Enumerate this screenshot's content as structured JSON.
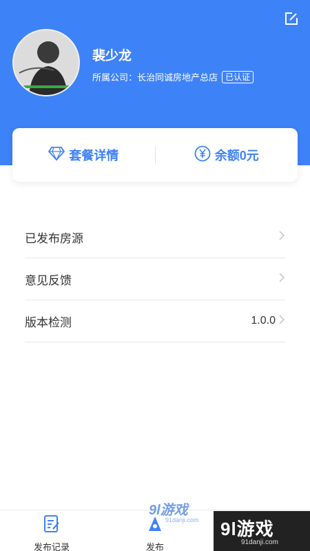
{
  "profile": {
    "name": "裴少龙",
    "company_label": "所属公司：",
    "company_name": "长治同诚房地产总店",
    "verified_badge": "已认证"
  },
  "card": {
    "package_label": "套餐详情",
    "balance_label": "余额0元"
  },
  "menu": {
    "items": [
      {
        "label": "已发布房源",
        "value": ""
      },
      {
        "label": "意见反馈",
        "value": ""
      },
      {
        "label": "版本检测",
        "value": "1.0.0"
      }
    ]
  },
  "tabs": {
    "records_label": "发布记录",
    "publish_label": "发布"
  },
  "watermarks": {
    "center_big": "9l游戏",
    "center_small": "91danji.com",
    "right_big": "9l游戏",
    "right_small": "91danji.com"
  },
  "colors": {
    "brand": "#3e82f7",
    "text": "#333333",
    "divider": "#e6e6e6"
  },
  "icons": {
    "edit": "edit-icon",
    "package": "diamond-icon",
    "balance": "yuan-coin-icon",
    "chevron": "chevron-right-icon",
    "records": "document-edit-icon",
    "publish": "publish-icon"
  }
}
